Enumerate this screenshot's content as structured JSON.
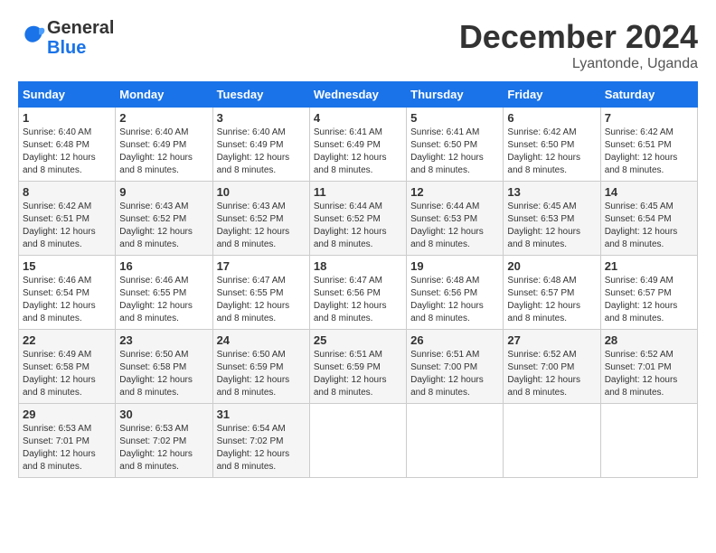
{
  "header": {
    "logo_general": "General",
    "logo_blue": "Blue",
    "month_title": "December 2024",
    "location": "Lyantonde, Uganda"
  },
  "days_of_week": [
    "Sunday",
    "Monday",
    "Tuesday",
    "Wednesday",
    "Thursday",
    "Friday",
    "Saturday"
  ],
  "weeks": [
    [
      {
        "day": "1",
        "sunrise": "6:40 AM",
        "sunset": "6:48 PM",
        "daylight": "12 hours and 8 minutes."
      },
      {
        "day": "2",
        "sunrise": "6:40 AM",
        "sunset": "6:49 PM",
        "daylight": "12 hours and 8 minutes."
      },
      {
        "day": "3",
        "sunrise": "6:40 AM",
        "sunset": "6:49 PM",
        "daylight": "12 hours and 8 minutes."
      },
      {
        "day": "4",
        "sunrise": "6:41 AM",
        "sunset": "6:49 PM",
        "daylight": "12 hours and 8 minutes."
      },
      {
        "day": "5",
        "sunrise": "6:41 AM",
        "sunset": "6:50 PM",
        "daylight": "12 hours and 8 minutes."
      },
      {
        "day": "6",
        "sunrise": "6:42 AM",
        "sunset": "6:50 PM",
        "daylight": "12 hours and 8 minutes."
      },
      {
        "day": "7",
        "sunrise": "6:42 AM",
        "sunset": "6:51 PM",
        "daylight": "12 hours and 8 minutes."
      }
    ],
    [
      {
        "day": "8",
        "sunrise": "6:42 AM",
        "sunset": "6:51 PM",
        "daylight": "12 hours and 8 minutes."
      },
      {
        "day": "9",
        "sunrise": "6:43 AM",
        "sunset": "6:52 PM",
        "daylight": "12 hours and 8 minutes."
      },
      {
        "day": "10",
        "sunrise": "6:43 AM",
        "sunset": "6:52 PM",
        "daylight": "12 hours and 8 minutes."
      },
      {
        "day": "11",
        "sunrise": "6:44 AM",
        "sunset": "6:52 PM",
        "daylight": "12 hours and 8 minutes."
      },
      {
        "day": "12",
        "sunrise": "6:44 AM",
        "sunset": "6:53 PM",
        "daylight": "12 hours and 8 minutes."
      },
      {
        "day": "13",
        "sunrise": "6:45 AM",
        "sunset": "6:53 PM",
        "daylight": "12 hours and 8 minutes."
      },
      {
        "day": "14",
        "sunrise": "6:45 AM",
        "sunset": "6:54 PM",
        "daylight": "12 hours and 8 minutes."
      }
    ],
    [
      {
        "day": "15",
        "sunrise": "6:46 AM",
        "sunset": "6:54 PM",
        "daylight": "12 hours and 8 minutes."
      },
      {
        "day": "16",
        "sunrise": "6:46 AM",
        "sunset": "6:55 PM",
        "daylight": "12 hours and 8 minutes."
      },
      {
        "day": "17",
        "sunrise": "6:47 AM",
        "sunset": "6:55 PM",
        "daylight": "12 hours and 8 minutes."
      },
      {
        "day": "18",
        "sunrise": "6:47 AM",
        "sunset": "6:56 PM",
        "daylight": "12 hours and 8 minutes."
      },
      {
        "day": "19",
        "sunrise": "6:48 AM",
        "sunset": "6:56 PM",
        "daylight": "12 hours and 8 minutes."
      },
      {
        "day": "20",
        "sunrise": "6:48 AM",
        "sunset": "6:57 PM",
        "daylight": "12 hours and 8 minutes."
      },
      {
        "day": "21",
        "sunrise": "6:49 AM",
        "sunset": "6:57 PM",
        "daylight": "12 hours and 8 minutes."
      }
    ],
    [
      {
        "day": "22",
        "sunrise": "6:49 AM",
        "sunset": "6:58 PM",
        "daylight": "12 hours and 8 minutes."
      },
      {
        "day": "23",
        "sunrise": "6:50 AM",
        "sunset": "6:58 PM",
        "daylight": "12 hours and 8 minutes."
      },
      {
        "day": "24",
        "sunrise": "6:50 AM",
        "sunset": "6:59 PM",
        "daylight": "12 hours and 8 minutes."
      },
      {
        "day": "25",
        "sunrise": "6:51 AM",
        "sunset": "6:59 PM",
        "daylight": "12 hours and 8 minutes."
      },
      {
        "day": "26",
        "sunrise": "6:51 AM",
        "sunset": "7:00 PM",
        "daylight": "12 hours and 8 minutes."
      },
      {
        "day": "27",
        "sunrise": "6:52 AM",
        "sunset": "7:00 PM",
        "daylight": "12 hours and 8 minutes."
      },
      {
        "day": "28",
        "sunrise": "6:52 AM",
        "sunset": "7:01 PM",
        "daylight": "12 hours and 8 minutes."
      }
    ],
    [
      {
        "day": "29",
        "sunrise": "6:53 AM",
        "sunset": "7:01 PM",
        "daylight": "12 hours and 8 minutes."
      },
      {
        "day": "30",
        "sunrise": "6:53 AM",
        "sunset": "7:02 PM",
        "daylight": "12 hours and 8 minutes."
      },
      {
        "day": "31",
        "sunrise": "6:54 AM",
        "sunset": "7:02 PM",
        "daylight": "12 hours and 8 minutes."
      },
      null,
      null,
      null,
      null
    ]
  ]
}
